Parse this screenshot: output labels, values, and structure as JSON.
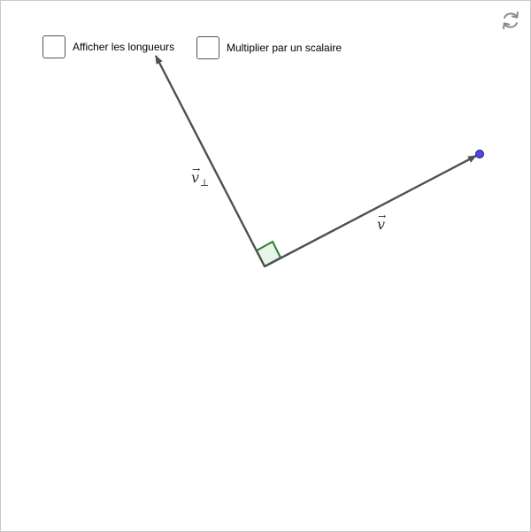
{
  "checkboxes": [
    {
      "label": "Afficher les longueurs",
      "checked": false
    },
    {
      "label": "Multiplier par un scalaire",
      "checked": false
    }
  ],
  "icons": {
    "reset": "reset-icon"
  },
  "labels": {
    "v": "v",
    "v_perp_base": "v",
    "v_perp_sub": "⊥",
    "vector_arrow": "→"
  },
  "colors": {
    "vector": "#505050",
    "right_angle_stroke": "#2e7d32",
    "right_angle_fill": "#e8f5e9",
    "point": "#4f46e5",
    "reset_icon": "#8a8a8a"
  }
}
